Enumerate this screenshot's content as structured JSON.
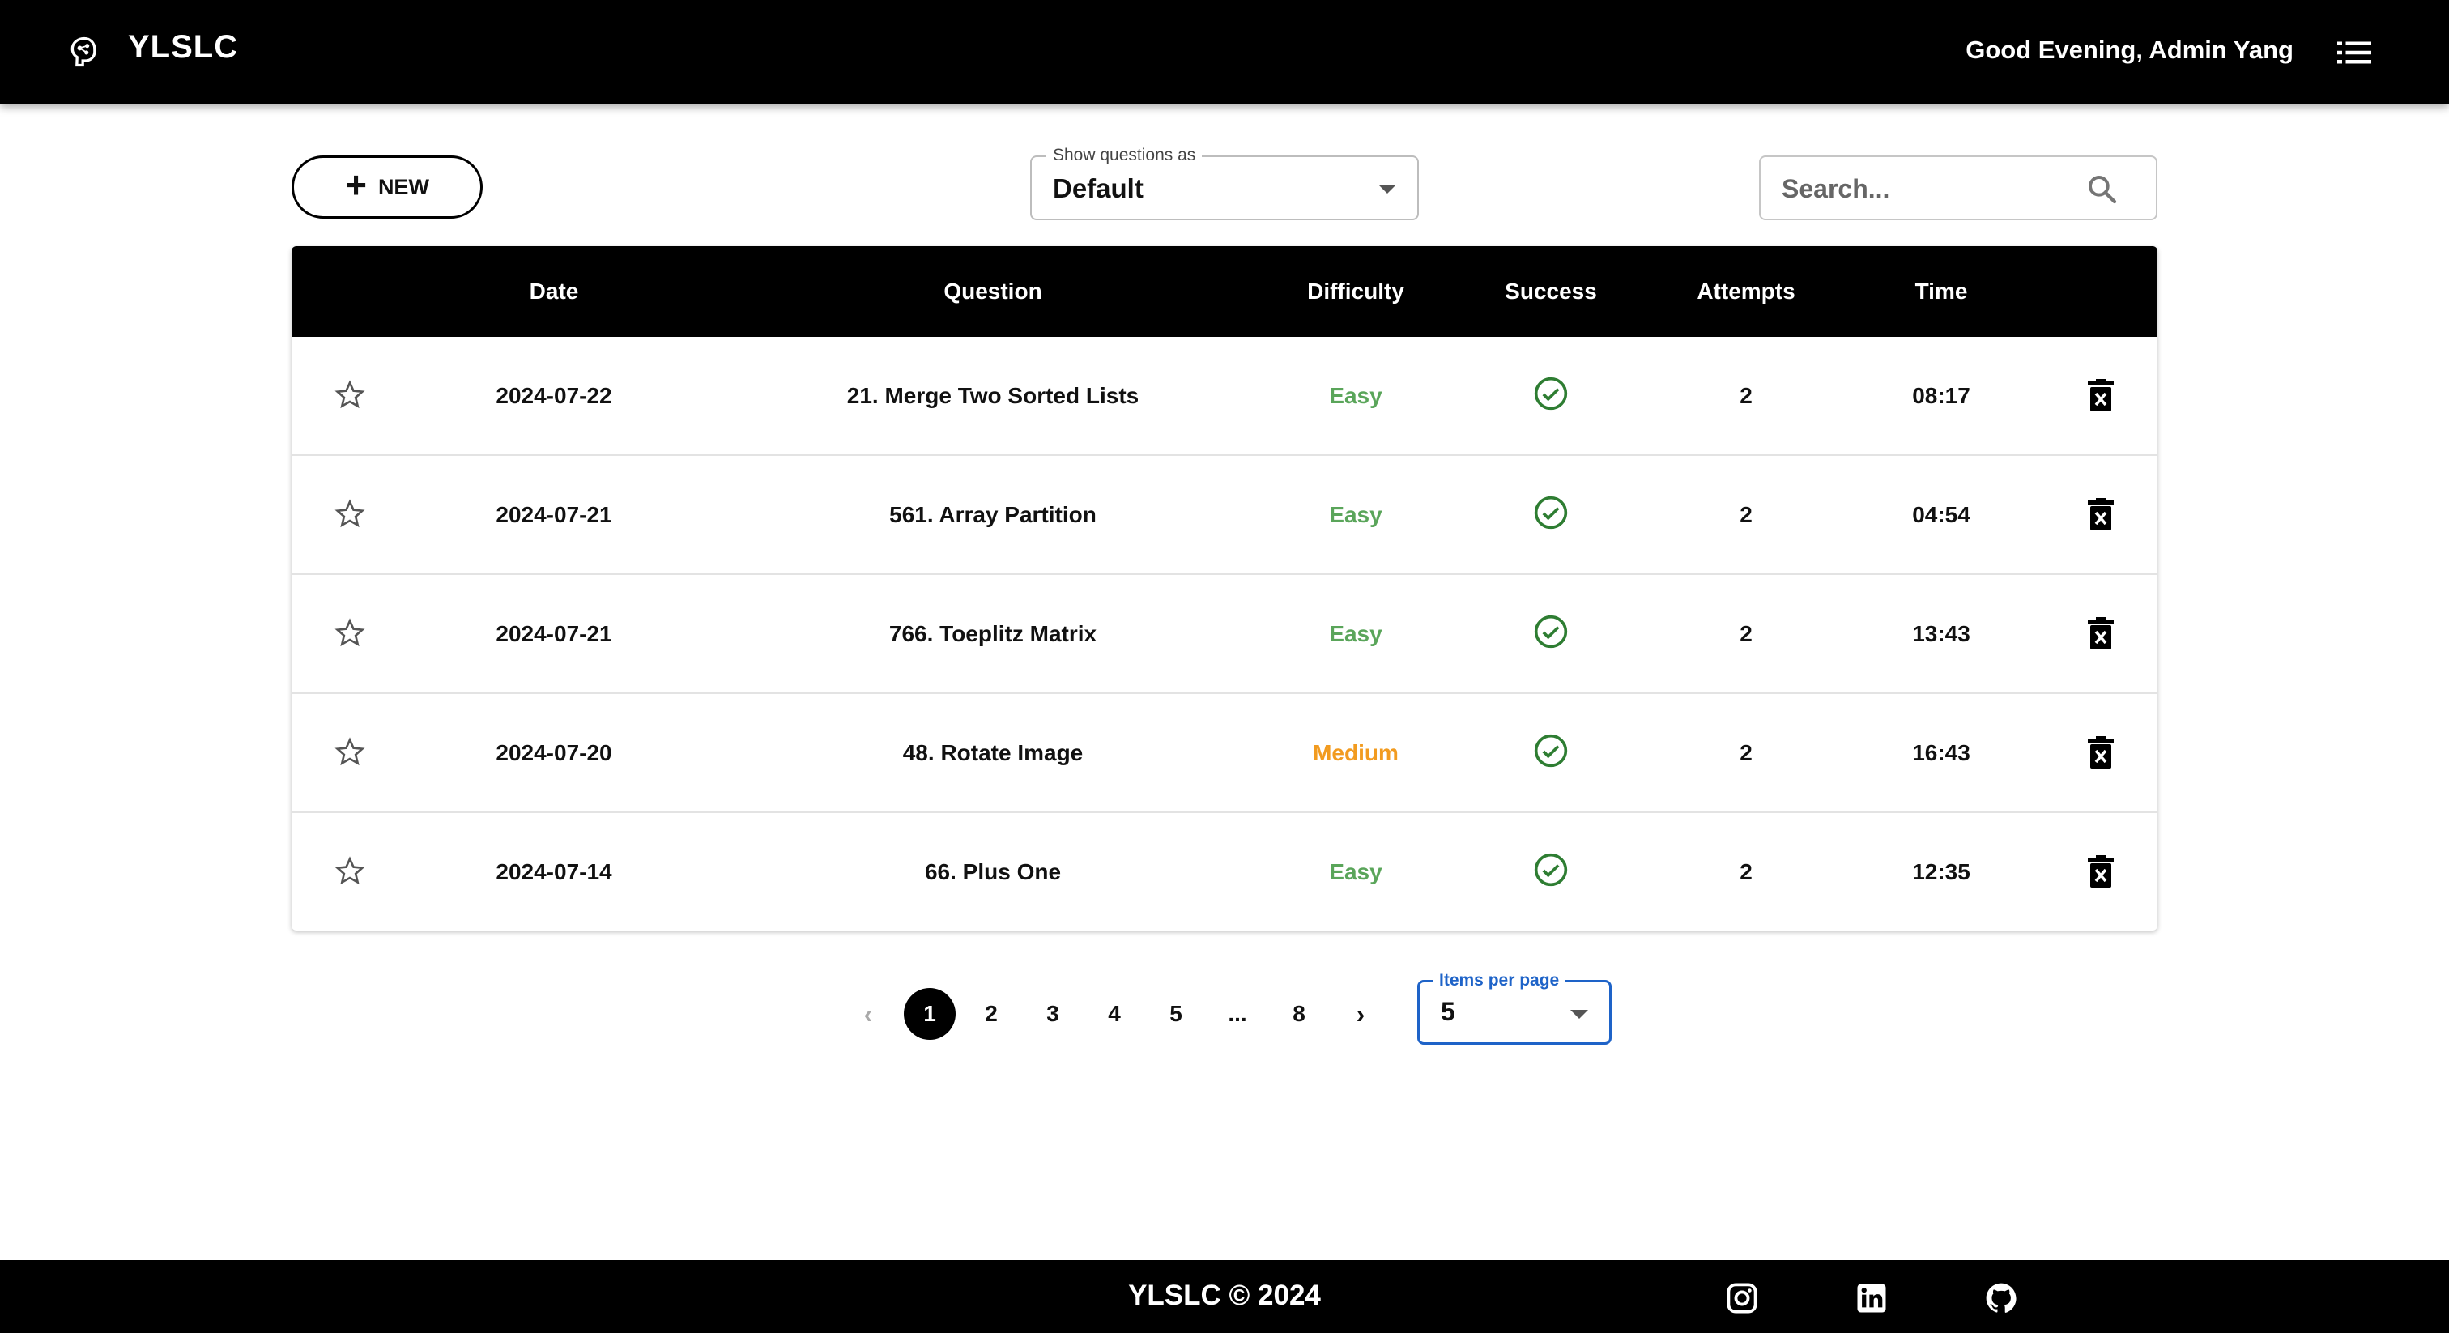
{
  "header": {
    "brand": "YLSLC",
    "greeting": "Good Evening, Admin Yang",
    "logo_icon": "brain-icon",
    "menu_icon": "list-menu-icon"
  },
  "toolbar": {
    "new_label": "NEW",
    "view_select_label": "Show questions as",
    "view_select_value": "Default",
    "search_placeholder": "Search..."
  },
  "table": {
    "columns": [
      "Date",
      "Question",
      "Difficulty",
      "Success",
      "Attempts",
      "Time"
    ],
    "rows": [
      {
        "date": "2024-07-22",
        "question": "21. Merge Two Sorted Lists",
        "difficulty": "Easy",
        "attempts": "2",
        "time": "08:17"
      },
      {
        "date": "2024-07-21",
        "question": "561. Array Partition",
        "difficulty": "Easy",
        "attempts": "2",
        "time": "04:54"
      },
      {
        "date": "2024-07-21",
        "question": "766. Toeplitz Matrix",
        "difficulty": "Easy",
        "attempts": "2",
        "time": "13:43"
      },
      {
        "date": "2024-07-20",
        "question": "48. Rotate Image",
        "difficulty": "Medium",
        "attempts": "2",
        "time": "16:43"
      },
      {
        "date": "2024-07-14",
        "question": "66. Plus One",
        "difficulty": "Easy",
        "attempts": "2",
        "time": "12:35"
      }
    ]
  },
  "pagination": {
    "prev": "‹",
    "pages": [
      "1",
      "2",
      "3",
      "4",
      "5",
      "...",
      "8"
    ],
    "current": "1",
    "next": "›",
    "items_per_page_label": "Items per page",
    "items_per_page_value": "5"
  },
  "footer": {
    "copyright": "YLSLC © 2024"
  },
  "colors": {
    "easy": "#5aa55a",
    "medium": "#f29b1f",
    "success": "#2e7d32",
    "accent": "#1e63c8"
  }
}
